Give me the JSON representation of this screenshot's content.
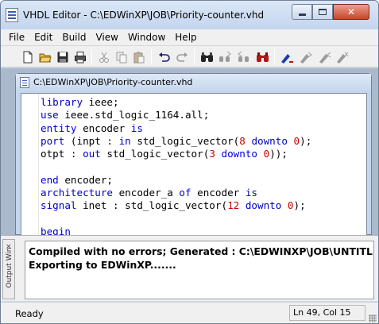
{
  "window": {
    "title": "VHDL Editor - C:\\EDWinXP\\JOB\\Priority-counter.vhd"
  },
  "menu": [
    "File",
    "Edit",
    "Build",
    "View",
    "Window",
    "Help"
  ],
  "toolbar": {
    "buttons": [
      "new-file-icon",
      "open-folder-icon",
      "save-icon",
      "print-icon",
      "cut-icon",
      "copy-icon",
      "paste-icon",
      "undo-icon",
      "redo-icon",
      "find-icon",
      "find-next-icon",
      "find-prev-icon",
      "replace-icon",
      "bookmark-toggle-icon",
      "bookmark-next-icon",
      "bookmark-prev-icon",
      "bookmark-clear-icon"
    ]
  },
  "child_window": {
    "title": "C:\\EDWinXP\\JOB\\Priority-counter.vhd"
  },
  "code_lines": [
    [
      {
        "t": "library",
        "c": "kw"
      },
      {
        "t": " ieee;",
        "c": "txt"
      }
    ],
    [
      {
        "t": "use",
        "c": "kw"
      },
      {
        "t": " ieee.std_logic_1164.all;",
        "c": "txt"
      }
    ],
    [
      {
        "t": "entity",
        "c": "kw"
      },
      {
        "t": " encoder ",
        "c": "txt"
      },
      {
        "t": "is",
        "c": "kw"
      }
    ],
    [
      {
        "t": "port",
        "c": "kw"
      },
      {
        "t": " (inpt : ",
        "c": "txt"
      },
      {
        "t": "in",
        "c": "kw"
      },
      {
        "t": " std_logic_vector(",
        "c": "txt"
      },
      {
        "t": "8",
        "c": "num"
      },
      {
        "t": " ",
        "c": "txt"
      },
      {
        "t": "downto",
        "c": "kw"
      },
      {
        "t": " ",
        "c": "txt"
      },
      {
        "t": "0",
        "c": "num"
      },
      {
        "t": ");",
        "c": "txt"
      }
    ],
    [
      {
        "t": "otpt : ",
        "c": "txt"
      },
      {
        "t": "out",
        "c": "kw"
      },
      {
        "t": " std_logic_vector(",
        "c": "txt"
      },
      {
        "t": "3",
        "c": "num"
      },
      {
        "t": " ",
        "c": "txt"
      },
      {
        "t": "downto",
        "c": "kw"
      },
      {
        "t": " ",
        "c": "txt"
      },
      {
        "t": "0",
        "c": "num"
      },
      {
        "t": "));",
        "c": "txt"
      }
    ],
    [],
    [
      {
        "t": "end",
        "c": "kw"
      },
      {
        "t": " encoder;",
        "c": "txt"
      }
    ],
    [
      {
        "t": "architecture",
        "c": "kw"
      },
      {
        "t": " encoder_a ",
        "c": "txt"
      },
      {
        "t": "of",
        "c": "kw"
      },
      {
        "t": " encoder ",
        "c": "txt"
      },
      {
        "t": "is",
        "c": "kw"
      }
    ],
    [
      {
        "t": "signal",
        "c": "kw"
      },
      {
        "t": " inet : std_logic_vector(",
        "c": "txt"
      },
      {
        "t": "12",
        "c": "num"
      },
      {
        "t": " ",
        "c": "txt"
      },
      {
        "t": "downto",
        "c": "kw"
      },
      {
        "t": " ",
        "c": "txt"
      },
      {
        "t": "0",
        "c": "num"
      },
      {
        "t": ");",
        "c": "txt"
      }
    ],
    [],
    [
      {
        "t": "begin",
        "c": "kw"
      }
    ]
  ],
  "output": {
    "tab_label": "Output Win",
    "close_glyph": "×",
    "lines": [
      "Compiled with no errors; Generated : C:\\EDWINXP\\JOB\\UNTITLED",
      "Exporting to EDWinXP......."
    ]
  },
  "status": {
    "left": "Ready",
    "position": "Ln 49, Col 15"
  },
  "colors": {
    "keyword": "#0000cc",
    "number": "#cc0000"
  }
}
